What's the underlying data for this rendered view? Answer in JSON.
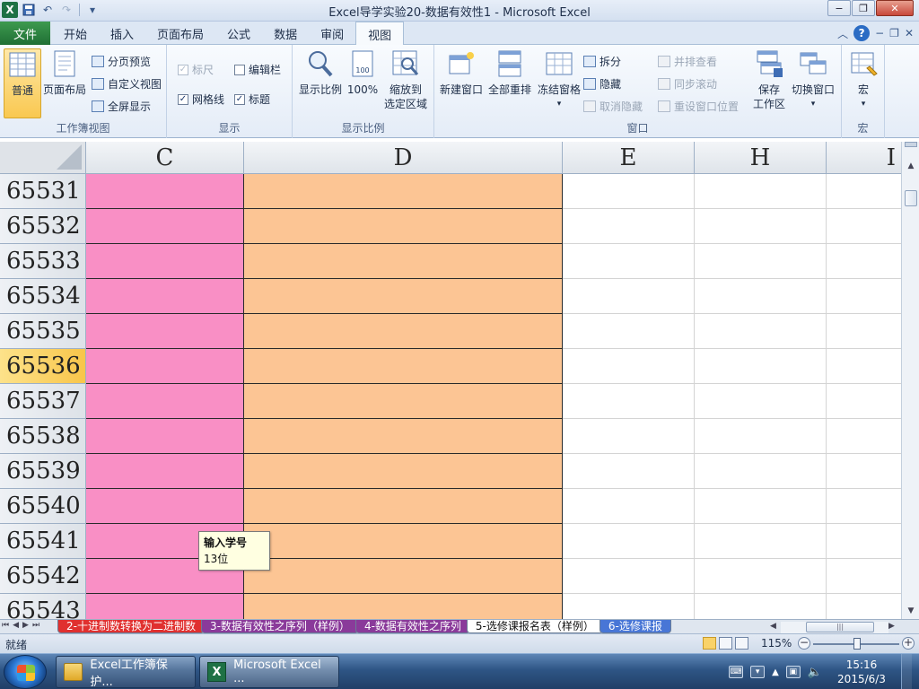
{
  "window": {
    "title": "Excel导学实验20-数据有效性1  -  Microsoft Excel",
    "controls": {
      "minimize": "−",
      "restore": "❐",
      "close": "✕"
    }
  },
  "qat": {
    "undo": "↶",
    "redo": "↷",
    "customize": "▾"
  },
  "ribbon_tabs": {
    "file": "文件",
    "tabs": [
      "开始",
      "插入",
      "页面布局",
      "公式",
      "数据",
      "审阅",
      "视图"
    ],
    "active": "视图"
  },
  "ribbon": {
    "workbook_views": {
      "label": "工作簿视图",
      "normal": "普通",
      "page_layout": "页面布局",
      "page_break": "分页预览",
      "custom_views": "自定义视图",
      "full_screen": "全屏显示"
    },
    "show": {
      "label": "显示",
      "ruler": "标尺",
      "formula_bar": "编辑栏",
      "gridlines": "网格线",
      "headings": "标题",
      "check": "✓"
    },
    "zoom": {
      "label": "显示比例",
      "zoom": "显示比例",
      "zoom100": "100%",
      "zoom_selection_1": "缩放到",
      "zoom_selection_2": "选定区域"
    },
    "window": {
      "label": "窗口",
      "new_window": "新建窗口",
      "arrange_all": "全部重排",
      "freeze_panes": "冻结窗格",
      "split": "拆分",
      "hide": "隐藏",
      "unhide": "取消隐藏",
      "side_by_side": "并排查看",
      "sync_scroll": "同步滚动",
      "reset_position": "重设窗口位置",
      "save_workspace_1": "保存",
      "save_workspace_2": "工作区",
      "switch_windows": "切换窗口"
    },
    "macros": {
      "label": "宏",
      "macros": "宏"
    }
  },
  "grid": {
    "columns": [
      "C",
      "D",
      "E",
      "H",
      "I"
    ],
    "rows": [
      "65531",
      "65532",
      "65533",
      "65534",
      "65535",
      "65536",
      "65537",
      "65538",
      "65539",
      "65540",
      "65541",
      "65542",
      "65543"
    ],
    "selected_row": "65536",
    "colors": {
      "col_c": "#f98fc5",
      "col_d": "#fcc594",
      "selected_row_header": "#f8c54a"
    }
  },
  "tooltip": {
    "title": "输入学号",
    "body": "13位"
  },
  "sheet_tabs": [
    {
      "label": "2-十进制数转换为二进制数",
      "color": "red"
    },
    {
      "label": "3-数据有效性之序列（样例）",
      "color": "purple"
    },
    {
      "label": "4-数据有效性之序列",
      "color": "purple"
    },
    {
      "label": "5-选修课报名表（样例）",
      "color": "active"
    },
    {
      "label": "6-选修课报",
      "color": "blue"
    }
  ],
  "status": {
    "text": "就绪",
    "zoom": "115%"
  },
  "taskbar": {
    "items": [
      {
        "label": "Excel工作簿保护...",
        "icon": "folder-icon"
      },
      {
        "label": "Microsoft Excel ...",
        "icon": "excel-icon"
      }
    ],
    "time": "15:16",
    "date": "2015/6/3"
  }
}
